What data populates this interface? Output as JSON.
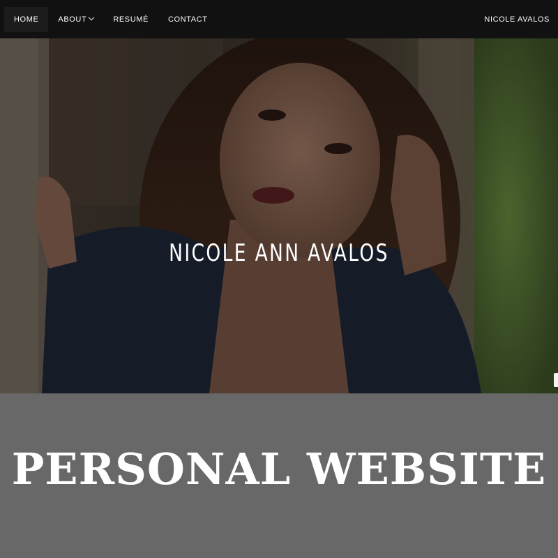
{
  "nav": {
    "items": [
      {
        "label": "HOME",
        "active": true
      },
      {
        "label": "ABOUT",
        "dropdown": true
      },
      {
        "label": "RESUMÉ"
      },
      {
        "label": "CONTACT"
      }
    ],
    "brand": "NICOLE AVALOS"
  },
  "hero": {
    "title": "NICOLE ANN AVALOS"
  },
  "banner": {
    "text": "PERSONAL WEBSITE"
  },
  "colors": {
    "navbar": "#111111",
    "banner": "#686868",
    "text": "#ffffff"
  }
}
